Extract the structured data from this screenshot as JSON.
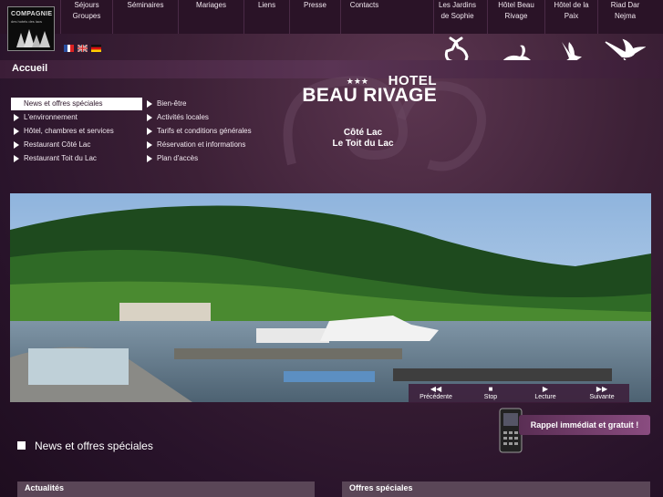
{
  "logo": {
    "line1": "COMPAGNIE",
    "line2": "des hotels des lacs"
  },
  "nav": {
    "items": [
      {
        "line1": "Séjours",
        "line2": "Groupes"
      },
      {
        "line1": "Séminaires",
        "line2": ""
      },
      {
        "line1": "Mariages",
        "line2": ""
      },
      {
        "line1": "Liens",
        "line2": ""
      },
      {
        "line1": "Presse",
        "line2": ""
      },
      {
        "line1": "Contacts",
        "line2": ""
      },
      {
        "line1": "Les Jardins",
        "line2": "de Sophie"
      },
      {
        "line1": "Hôtel Beau",
        "line2": "Rivage"
      },
      {
        "line1": "Hôtel de la",
        "line2": "Paix"
      },
      {
        "line1": "Riad Dar",
        "line2": "Nejma"
      }
    ]
  },
  "flags": [
    "flag-fr-icon",
    "flag-uk-icon",
    "flag-de-icon"
  ],
  "breadcrumb": "Accueil",
  "menu": {
    "col1": [
      "News et offres spéciales",
      "L'environnement",
      "Hôtel, chambres et services",
      "Restaurant Côté Lac",
      "Restaurant Toit du Lac"
    ],
    "col2": [
      "Bien-être",
      "Activités locales",
      "Tarifs et conditions générales",
      "Réservation et informations",
      "Plan d'accès"
    ],
    "active_index": 0
  },
  "hotel": {
    "stars": "★★★",
    "label": "HOTEL",
    "name": "BEAU RIVAGE",
    "restaurant1": "Côté Lac",
    "restaurant2": "Le Toit du Lac"
  },
  "slideshow": {
    "prev": "Précédente",
    "stop": "Stop",
    "play": "Lecture",
    "next": "Suivante"
  },
  "news_heading": "News et offres spéciales",
  "callback": "Rappel immédiat et gratuit !",
  "sections": {
    "left": "Actualités",
    "right": "Offres spéciales"
  },
  "colors": {
    "accent": "#5a3454",
    "bar": "#5a4657",
    "top": "#2a1327"
  }
}
